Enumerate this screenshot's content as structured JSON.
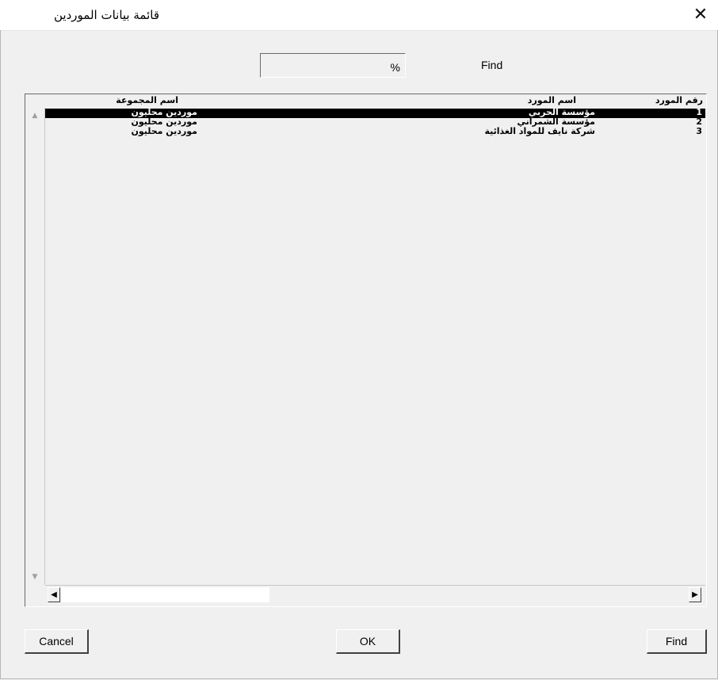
{
  "window": {
    "title": "قائمة بيانات الموردين",
    "close_glyph": "✕"
  },
  "search": {
    "value": "%",
    "label": "Find"
  },
  "grid": {
    "columns": {
      "number": "رقم المورد",
      "name": "اسم المورد",
      "group": "اسم المجموعة"
    },
    "rows": [
      {
        "number": "1",
        "name": "مؤسسة الحربي",
        "group": "موردين محليون",
        "selected": true
      },
      {
        "number": "2",
        "name": "مؤسسة الشمراني",
        "group": "موردين محليون",
        "selected": false
      },
      {
        "number": "3",
        "name": "شركة نايف للمواد الغذائية",
        "group": "موردين محليون",
        "selected": false
      }
    ],
    "scroll_up_icon": "▲",
    "scroll_down_icon": "▼",
    "scroll_left_icon": "◀",
    "scroll_right_icon": "▶"
  },
  "buttons": {
    "cancel": "Cancel",
    "ok": "OK",
    "find": "Find"
  },
  "colors": {
    "background": "#f0f0f0",
    "selection": "#000000",
    "selection_text": "#ffffff"
  }
}
